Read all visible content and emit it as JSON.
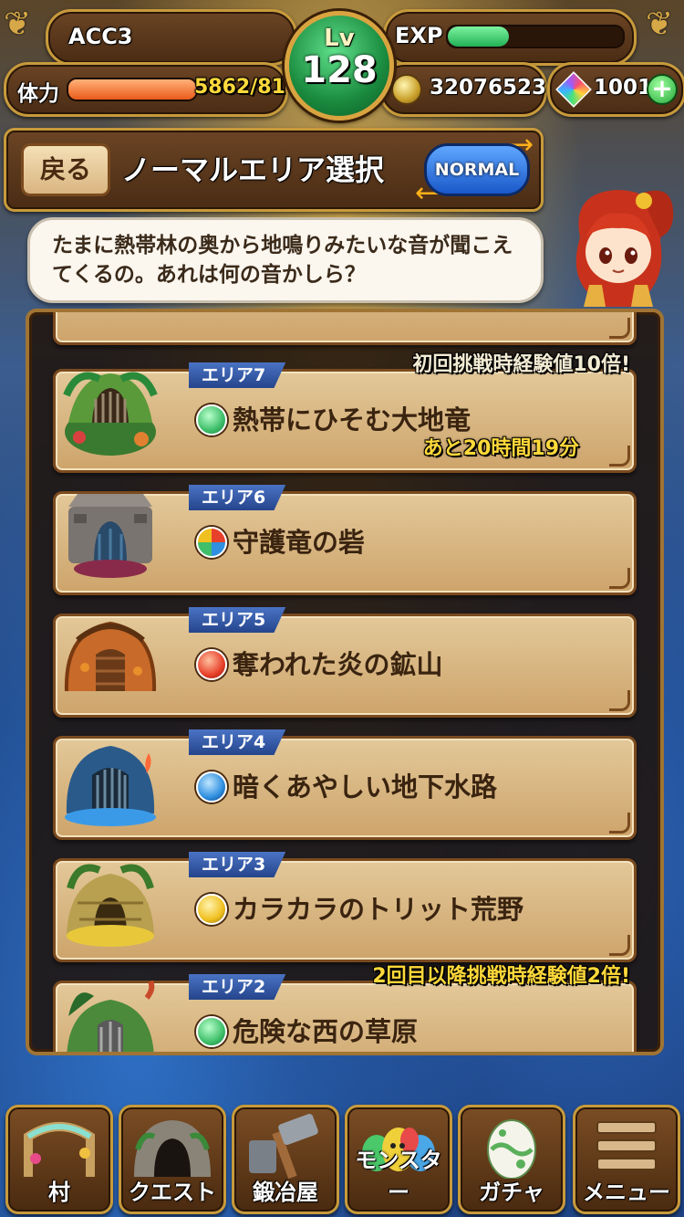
{
  "header": {
    "player_name": "ACC3",
    "level_label": "Lv",
    "level": "128",
    "exp_label": "EXP",
    "exp_progress": 0.35,
    "stamina_label": "体力",
    "stamina_value": "5862/81",
    "stamina_progress": 1.0,
    "gold": "32076523",
    "gems": "1001",
    "gem_add": "+"
  },
  "title_bar": {
    "back_label": "戻る",
    "title": "ノーマルエリア選択",
    "mode_label": "NORMAL"
  },
  "guide": {
    "message": "たまに熱帯林の奥から地鳴りみたいな音が聞こえてくるの。あれは何の音かしら？"
  },
  "areas": [
    {
      "tag": "エリア7",
      "name": "熱帯にひそむ大地竜",
      "element": "wood",
      "notice": "初回挑戦時経験値10倍!",
      "timer": "あと20時間19分"
    },
    {
      "tag": "エリア6",
      "name": "守護竜の砦",
      "element": "multi",
      "notice": "",
      "timer": ""
    },
    {
      "tag": "エリア5",
      "name": "奪われた炎の鉱山",
      "element": "fire",
      "notice": "",
      "timer": ""
    },
    {
      "tag": "エリア4",
      "name": "暗くあやしい地下水路",
      "element": "water",
      "notice": "",
      "timer": ""
    },
    {
      "tag": "エリア3",
      "name": "カラカラのトリット荒野",
      "element": "thunder",
      "notice": "",
      "timer": ""
    },
    {
      "tag": "エリア2",
      "name": "危険な西の草原",
      "element": "wood",
      "notice": "2回目以降挑戦時経験値2倍!",
      "timer": ""
    }
  ],
  "colors": {
    "wood": "#3fbf6a",
    "fire": "#e8402a",
    "water": "#2f8fe0",
    "thunder": "#f0c020"
  },
  "nav": [
    {
      "label": "村",
      "icon": "village-gate-icon"
    },
    {
      "label": "クエスト",
      "icon": "cave-icon"
    },
    {
      "label": "鍛冶屋",
      "icon": "hammer-icon"
    },
    {
      "label": "モンスター",
      "icon": "monsters-icon"
    },
    {
      "label": "ガチャ",
      "icon": "egg-icon"
    },
    {
      "label": "メニュー",
      "icon": "menu-icon"
    }
  ]
}
